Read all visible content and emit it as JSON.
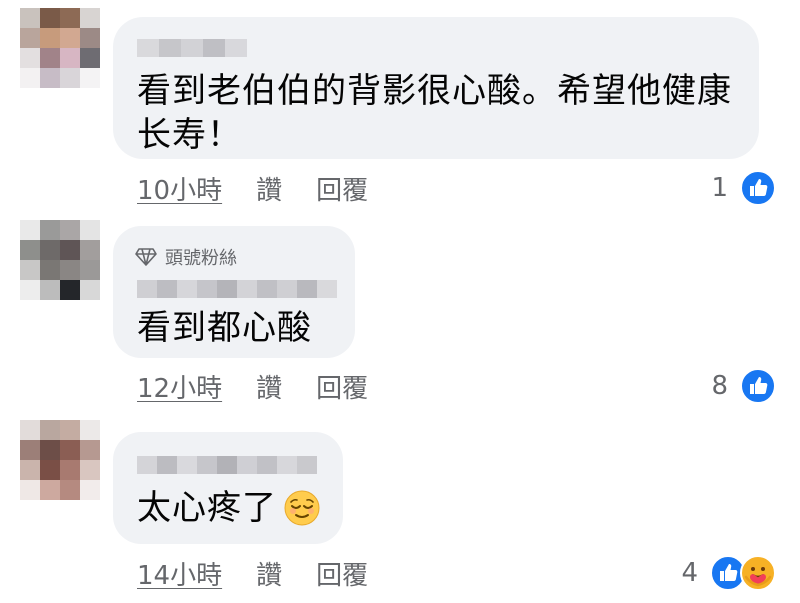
{
  "comments": [
    {
      "text_line1": "看到老伯伯的背影很心酸。希望他健康",
      "text_line2": "长寿！",
      "time": "10小時",
      "like_label": "讚",
      "reply_label": "回覆",
      "reaction_count": "1",
      "reactions": [
        "like-icon"
      ]
    },
    {
      "badge": "頭號粉絲",
      "text_line1": "看到都心酸",
      "time": "12小時",
      "like_label": "讚",
      "reply_label": "回覆",
      "reaction_count": "8",
      "reactions": [
        "like-icon"
      ]
    },
    {
      "text_line1": "太心疼了",
      "time": "14小時",
      "like_label": "讚",
      "reply_label": "回覆",
      "reaction_count": "4",
      "reactions": [
        "like-icon",
        "care-icon"
      ]
    }
  ],
  "colors": {
    "bubble": "#f0f2f5",
    "text": "#050505",
    "secondary": "#65676b",
    "like_blue": "#1877f2"
  }
}
